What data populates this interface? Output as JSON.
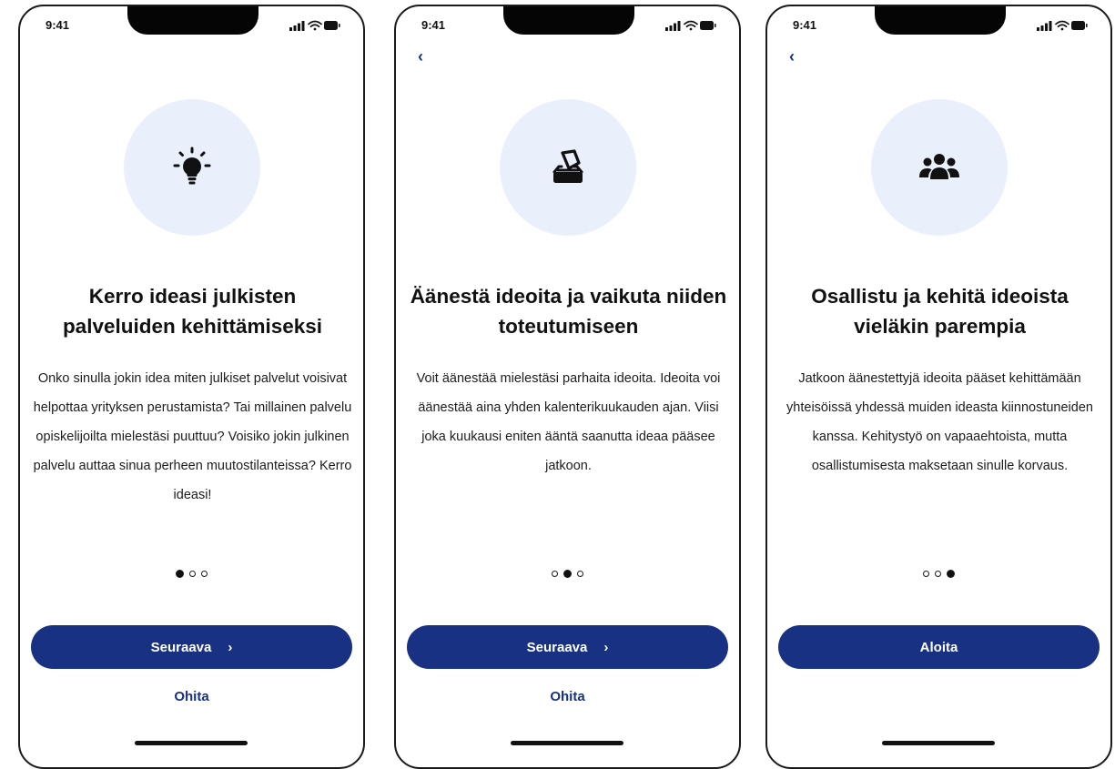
{
  "screens": [
    {
      "status_time": "9:41",
      "has_back": false,
      "icon": "lightbulb-icon",
      "title": "Kerro ideasi julkisten palveluiden kehittämiseksi",
      "body": "Onko sinulla jokin idea miten julkiset palvelut voisivat helpottaa yrityksen perustamista? Tai millainen palvelu opiskelijoilta mielestäsi puuttuu? Voisiko jokin julkinen palvelu auttaa sinua perheen muutostilanteissa? Kerro ideasi!",
      "page_index": 1,
      "page_count": 3,
      "primary_label": "Seuraava",
      "primary_chevron": "›",
      "secondary_label": "Ohita"
    },
    {
      "status_time": "9:41",
      "has_back": true,
      "back_glyph": "‹",
      "icon": "ballot-box-icon",
      "title": "Äänestä ideoita ja vaikuta niiden toteutumiseen",
      "body": "Voit äänestää mielestäsi parhaita ideoita. Ideoita voi äänestää aina yhden kalenterikuukauden ajan. Viisi joka kuukausi eniten ääntä saanutta ideaa pääsee jatkoon.",
      "page_index": 2,
      "page_count": 3,
      "primary_label": "Seuraava",
      "primary_chevron": "›",
      "secondary_label": "Ohita"
    },
    {
      "status_time": "9:41",
      "has_back": true,
      "back_glyph": "‹",
      "icon": "people-group-icon",
      "title": "Osallistu ja kehitä ideoista vieläkin parempia",
      "body": "Jatkoon äänestettyjä ideoita pääset kehittämään yhteisöissä yhdessä muiden ideasta kiinnostuneiden kanssa. Kehitystyö on vapaaehtoista, mutta osallistumisesta maksetaan sinulle korvaus.",
      "page_index": 3,
      "page_count": 3,
      "primary_label": "Aloita"
    }
  ],
  "colors": {
    "primary": "#183182",
    "illustration_bg": "#e9effb",
    "text": "#111111"
  }
}
